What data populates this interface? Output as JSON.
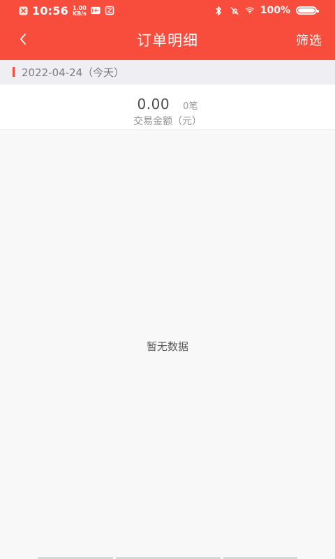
{
  "status_bar": {
    "time": "10:56",
    "network_speed_value": "1.00",
    "network_speed_unit": "KB/s",
    "battery_percent": "100%",
    "battery_level": 1.0,
    "icons": [
      "close-box-icon",
      "volte-icon",
      "screenshot-icon",
      "bluetooth-icon",
      "do-not-disturb-off-icon",
      "wifi-icon",
      "battery-icon"
    ]
  },
  "nav": {
    "back_icon": "chevron-left-icon",
    "title": "订单明细",
    "filter_label": "筛选"
  },
  "date_section": {
    "date_text": "2022-04-24（今天）",
    "accent_color": "#f84c3c"
  },
  "summary": {
    "amount": "0.00",
    "count": "0笔",
    "label": "交易金额（元）"
  },
  "empty_state": {
    "text": "暂无数据"
  },
  "theme": {
    "primary": "#f84c3c",
    "background": "#f8f8f8",
    "date_strip": "#eeeef3"
  }
}
